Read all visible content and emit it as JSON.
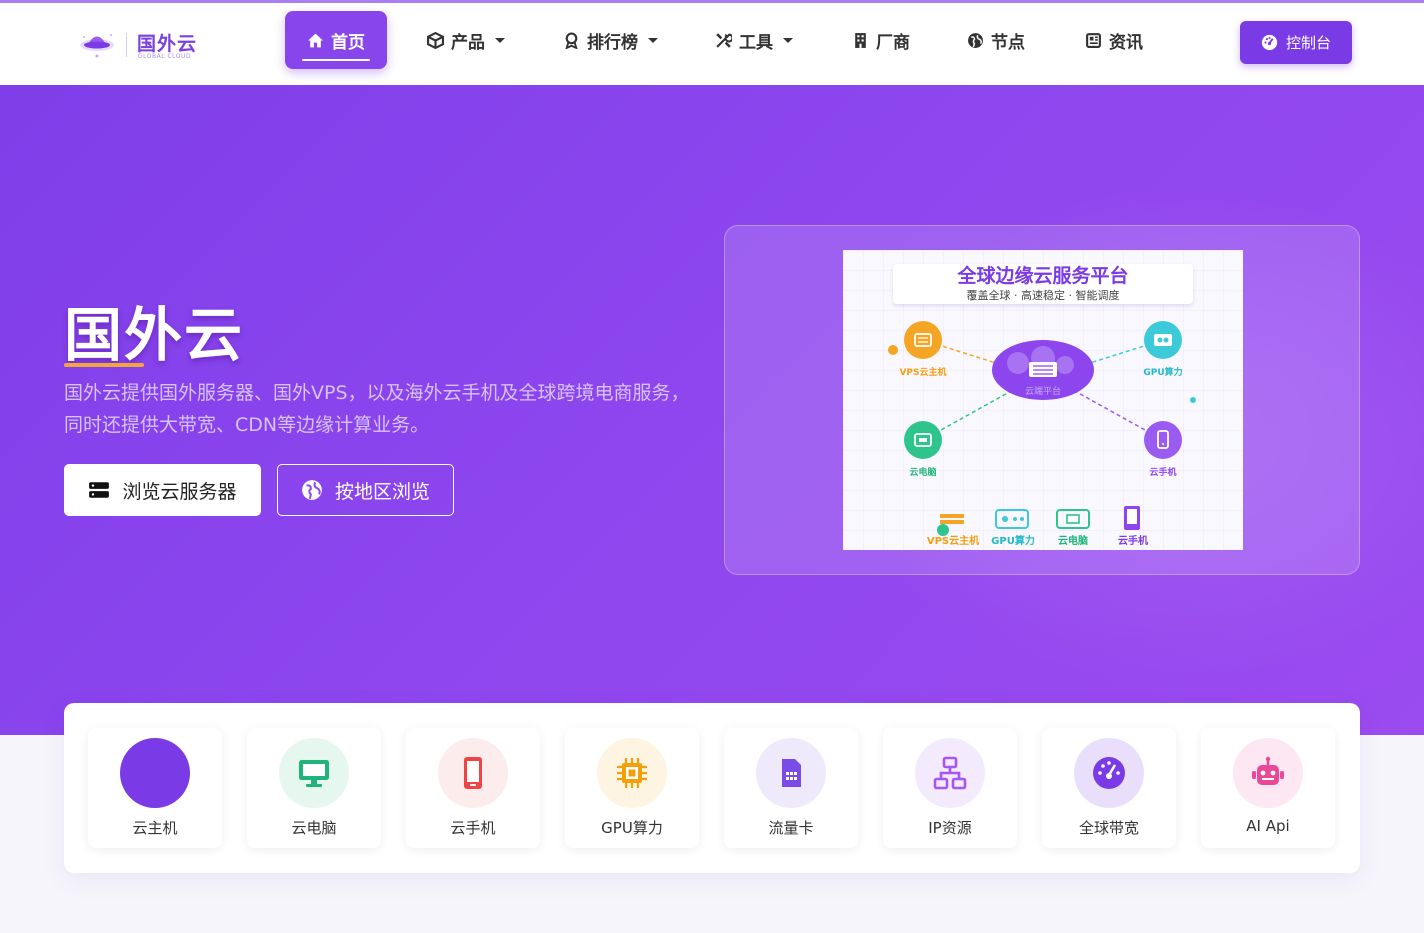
{
  "brand": {
    "name": "国外云",
    "subtitle": "GLOBAL CLOUD"
  },
  "nav": {
    "items": [
      {
        "label": "首页",
        "icon": "home-icon",
        "active": true
      },
      {
        "label": "产品",
        "icon": "cube-icon",
        "dropdown": true
      },
      {
        "label": "排行榜",
        "icon": "award-icon",
        "dropdown": true
      },
      {
        "label": "工具",
        "icon": "tools-icon",
        "dropdown": true
      },
      {
        "label": "厂商",
        "icon": "building-icon"
      },
      {
        "label": "节点",
        "icon": "globe-icon"
      },
      {
        "label": "资讯",
        "icon": "newspaper-icon"
      }
    ],
    "console_label": "控制台"
  },
  "hero": {
    "title": "国外云",
    "description": "国外云提供国外服务器、国外VPS，以及海外云手机及全球跨境电商服务，同时还提供大带宽、CDN等边缘计算业务。",
    "primary_button": "浏览云服务器",
    "secondary_button": "按地区浏览"
  },
  "illustration": {
    "title": "全球边缘云服务平台",
    "subtitle": "覆盖全球 · 高速稳定 · 智能调度",
    "center_label": "云端平台",
    "nodes": [
      "VPS云主机",
      "GPU算力",
      "云电脑",
      "云手机"
    ],
    "bottom": [
      "VPS云主机",
      "GPU算力",
      "云电脑",
      "云手机"
    ]
  },
  "features": [
    {
      "label": "云主机",
      "icon": "cloud-server-icon",
      "color": "#7a3be6",
      "bg": "#7a3be6"
    },
    {
      "label": "云电脑",
      "icon": "desktop-icon",
      "color": "#1fb47a",
      "bg": "#e6f7f0"
    },
    {
      "label": "云手机",
      "icon": "mobile-icon",
      "color": "#ef4444",
      "bg": "#fdecec"
    },
    {
      "label": "GPU算力",
      "icon": "chip-icon",
      "color": "#f59e0b",
      "bg": "#fef4e2"
    },
    {
      "label": "流量卡",
      "icon": "sim-card-icon",
      "color": "#7a4be6",
      "bg": "#efe9fc"
    },
    {
      "label": "IP资源",
      "icon": "network-icon",
      "color": "#a855f7",
      "bg": "#f3ebfd"
    },
    {
      "label": "全球带宽",
      "icon": "speedometer-icon",
      "color": "#7a3be6",
      "bg": "#eadffb"
    },
    {
      "label": "AI Api",
      "icon": "robot-icon",
      "color": "#ec4899",
      "bg": "#fde7f2"
    }
  ]
}
